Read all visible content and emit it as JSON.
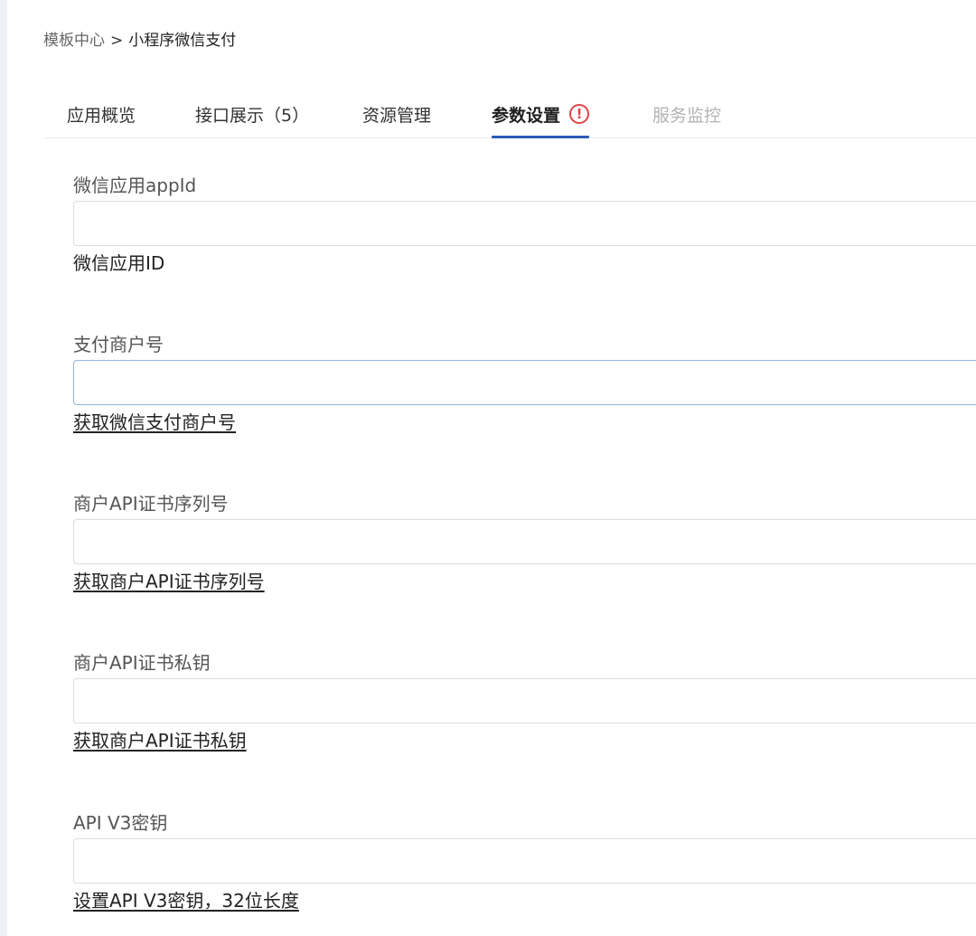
{
  "breadcrumb": {
    "root": "模板中心",
    "separator": ">",
    "current": "小程序微信支付"
  },
  "tabs": [
    {
      "label": "应用概览",
      "state": "normal"
    },
    {
      "label": "接口展示（5）",
      "state": "normal"
    },
    {
      "label": "资源管理",
      "state": "normal"
    },
    {
      "label": "参数设置",
      "state": "active",
      "icon": "exclamation-circle-icon"
    },
    {
      "label": "服务监控",
      "state": "disabled"
    }
  ],
  "fields": [
    {
      "label": "微信应用appId",
      "value": "",
      "help": "微信应用ID",
      "help_is_link": false
    },
    {
      "label": "支付商户号",
      "value": "",
      "help": "获取微信支付商户号",
      "help_is_link": true
    },
    {
      "label": "商户API证书序列号",
      "value": "",
      "help": "获取商户API证书序列号",
      "help_is_link": true
    },
    {
      "label": "商户API证书私钥",
      "value": "",
      "help": "获取商户API证书私钥",
      "help_is_link": true
    },
    {
      "label": "API V3密钥",
      "value": "",
      "help": "设置API V3密钥，32位长度",
      "help_is_link": true
    }
  ],
  "colors": {
    "active_tab_underline": "#2d5bb8",
    "warning": "#e04545",
    "focus_border": "#8fb4e0"
  }
}
